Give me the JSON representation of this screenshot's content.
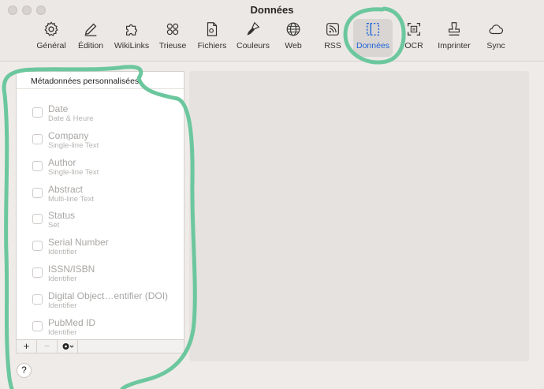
{
  "window": {
    "title": "Données"
  },
  "toolbar": {
    "items": [
      {
        "label": "Général",
        "icon": "gear-icon"
      },
      {
        "label": "Édition",
        "icon": "pencil-icon"
      },
      {
        "label": "WikiLinks",
        "icon": "puzzle-icon"
      },
      {
        "label": "Trieuse",
        "icon": "circles-icon"
      },
      {
        "label": "Fichiers",
        "icon": "document-icon"
      },
      {
        "label": "Couleurs",
        "icon": "brush-icon"
      },
      {
        "label": "Web",
        "icon": "globe-icon"
      },
      {
        "label": "RSS",
        "icon": "rss-icon"
      },
      {
        "label": "Données",
        "icon": "data-icon",
        "active": true
      },
      {
        "label": "OCR",
        "icon": "ocr-icon"
      },
      {
        "label": "Imprinter",
        "icon": "stamp-icon"
      },
      {
        "label": "Sync",
        "icon": "cloud-icon"
      }
    ],
    "active_color": "#1f63d8"
  },
  "metadata_panel": {
    "header": "Métadonnées personnalisées",
    "fields": [
      {
        "name": "Date",
        "type": "Date & Heure",
        "checked": false
      },
      {
        "name": "Company",
        "type": "Single-line Text",
        "checked": false
      },
      {
        "name": "Author",
        "type": "Single-line Text",
        "checked": false
      },
      {
        "name": "Abstract",
        "type": "Multi-line Text",
        "checked": false
      },
      {
        "name": "Status",
        "type": "Set",
        "checked": false
      },
      {
        "name": "Serial Number",
        "type": "Identifier",
        "checked": false
      },
      {
        "name": "ISSN/ISBN",
        "type": "Identifier",
        "checked": false
      },
      {
        "name": "Digital Object…entifier (DOI)",
        "type": "Identifier",
        "checked": false
      },
      {
        "name": "PubMed ID",
        "type": "Identifier",
        "checked": false
      }
    ],
    "footer": {
      "add": "+",
      "remove": "−"
    }
  },
  "help": "?",
  "annotation_color": "#6cc79e"
}
